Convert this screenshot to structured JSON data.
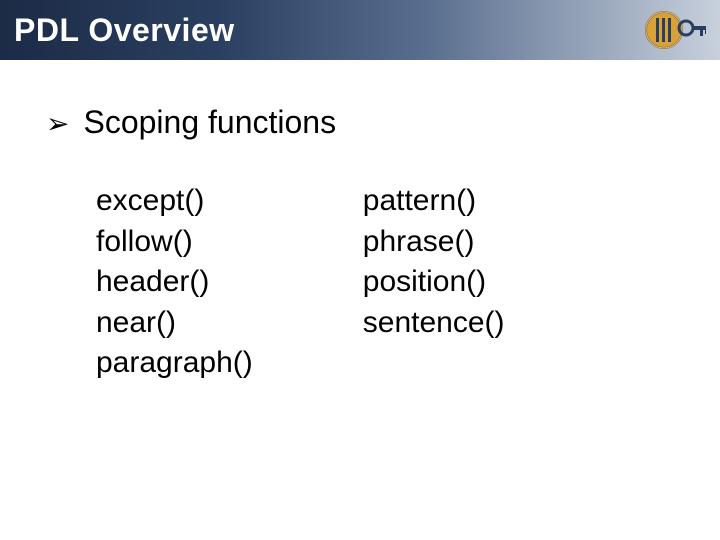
{
  "title": "PDL Overview",
  "bullet": {
    "marker": "➢",
    "text": "Scoping functions"
  },
  "columns": {
    "left": [
      "except()",
      "follow()",
      "header()",
      "near()",
      "paragraph()"
    ],
    "right": [
      "pattern()",
      "phrase()",
      "position()",
      "sentence()"
    ]
  }
}
